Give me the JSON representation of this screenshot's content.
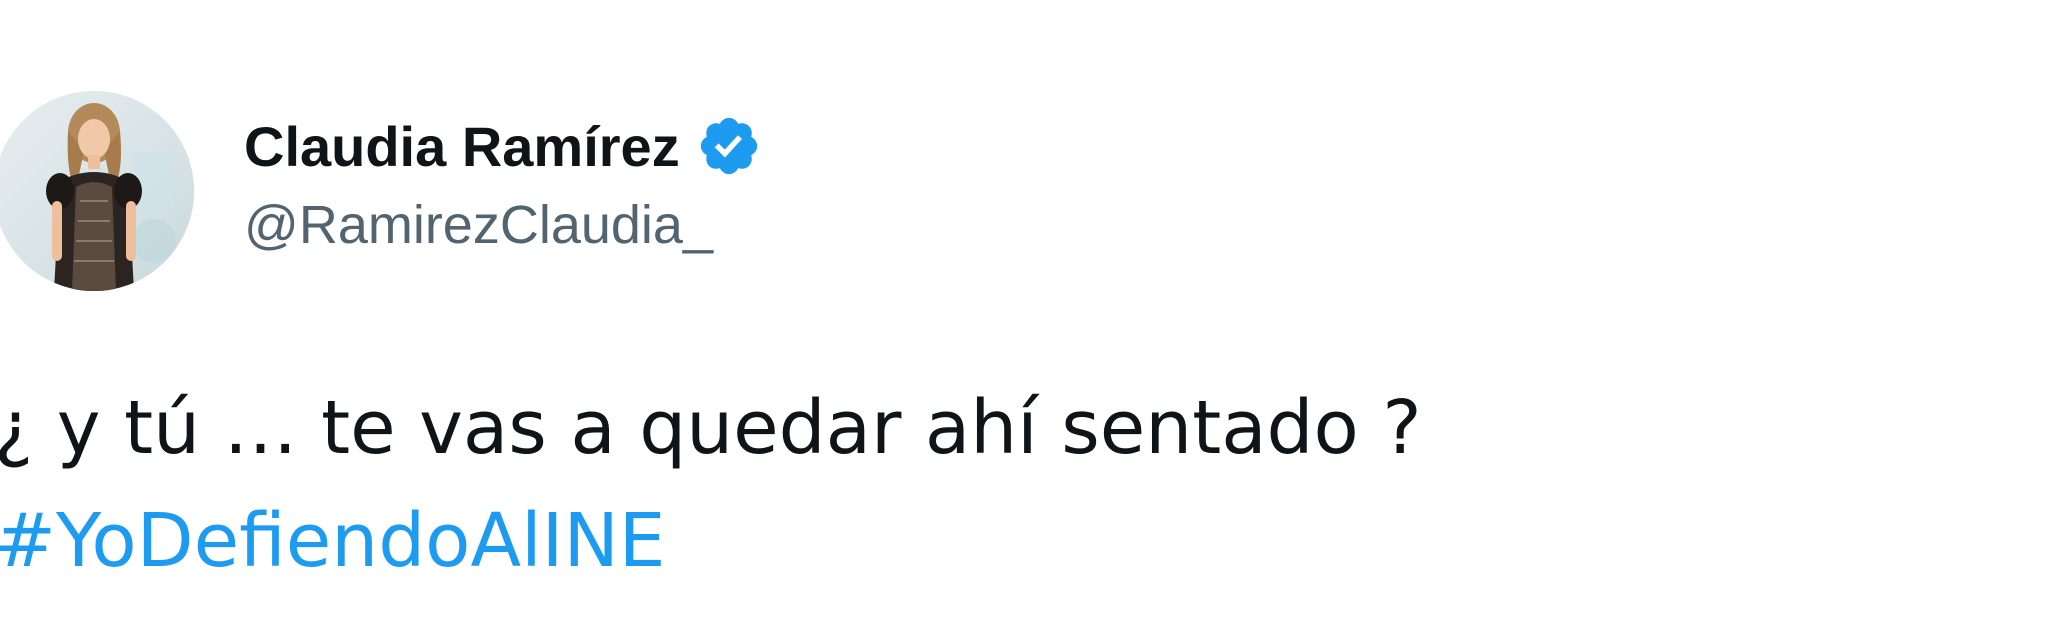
{
  "author": {
    "display_name": "Claudia Ramírez",
    "handle": "@RamirezClaudia_",
    "verified": true,
    "avatar_icon": "profile-photo"
  },
  "tweet": {
    "text_line": "¿ y tú … te vas a quedar ahí sentado ?",
    "hashtag": "#YoDefiendoAlINE"
  },
  "colors": {
    "text_primary": "#0f1419",
    "text_secondary": "#536471",
    "accent": "#1d9bf0",
    "background": "#ffffff"
  }
}
